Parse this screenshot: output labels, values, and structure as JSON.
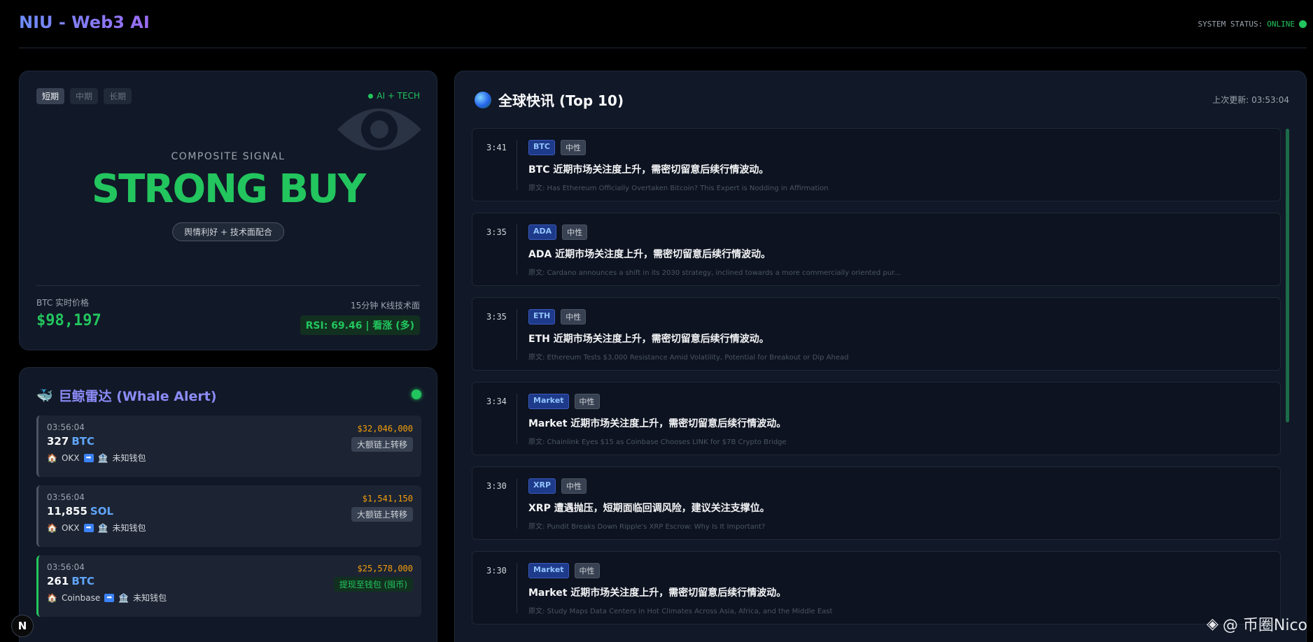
{
  "header": {
    "brand": "NIU - Web3 AI",
    "status_label": "SYSTEM STATUS:",
    "status_value": "ONLINE"
  },
  "signal": {
    "tabs": [
      "短期",
      "中期",
      "长期"
    ],
    "active_tab": 0,
    "ai_tag": "AI + TECH",
    "composite_label": "COMPOSITE SIGNAL",
    "signal_value": "STRONG BUY",
    "reason": "舆情利好 + 技术面配合",
    "price_label": "BTC 实时价格",
    "price": "$98,197",
    "kline_label": "15分钟 K线技术面",
    "rsi": "RSI: 69.46 | 看涨 (多)"
  },
  "whale": {
    "title": "巨鲸雷达 (Whale Alert)",
    "items": [
      {
        "time": "03:56:04",
        "usd": "$32,046,000",
        "amount": "327",
        "coin": "BTC",
        "type": "大额链上转移",
        "from": "OKX",
        "to": "未知钱包",
        "highlight": false
      },
      {
        "time": "03:56:04",
        "usd": "$1,541,150",
        "amount": "11,855",
        "coin": "SOL",
        "type": "大额链上转移",
        "from": "OKX",
        "to": "未知钱包",
        "highlight": false
      },
      {
        "time": "03:56:04",
        "usd": "$25,578,000",
        "amount": "261",
        "coin": "BTC",
        "type": "提现至钱包 (囤币)",
        "from": "Coinbase",
        "to": "未知钱包",
        "highlight": true
      }
    ]
  },
  "news": {
    "title": "全球快讯 (Top 10)",
    "updated": "上次更新: 03:53:04",
    "items": [
      {
        "time": "3:41",
        "coin": "BTC",
        "sentiment": "中性",
        "headline": "BTC 近期市场关注度上升，需密切留意后续行情波动。",
        "source": "原文: Has Ethereum Officially Overtaken Bitcoin? This Expert is Nodding in Affirmation"
      },
      {
        "time": "3:35",
        "coin": "ADA",
        "sentiment": "中性",
        "headline": "ADA 近期市场关注度上升，需密切留意后续行情波动。",
        "source": "原文: Cardano announces a shift in its 2030 strategy, inclined towards a more commercially oriented pur..."
      },
      {
        "time": "3:35",
        "coin": "ETH",
        "sentiment": "中性",
        "headline": "ETH 近期市场关注度上升，需密切留意后续行情波动。",
        "source": "原文: Ethereum Tests $3,000 Resistance Amid Volatility, Potential for Breakout or Dip Ahead"
      },
      {
        "time": "3:34",
        "coin": "Market",
        "sentiment": "中性",
        "headline": "Market 近期市场关注度上升，需密切留意后续行情波动。",
        "source": "原文: Chainlink Eyes $15 as Coinbase Chooses LINK for $7B Crypto Bridge"
      },
      {
        "time": "3:30",
        "coin": "XRP",
        "sentiment": "中性",
        "headline": "XRP 遭遇抛压，短期面临回调风险，建议关注支撑位。",
        "source": "原文: Pundit Breaks Down Ripple's XRP Escrow: Why Is It Important?"
      },
      {
        "time": "3:30",
        "coin": "Market",
        "sentiment": "中性",
        "headline": "Market 近期市场关注度上升，需密切留意后续行情波动。",
        "source": "原文: Study Maps Data Centers in Hot Climates Across Asia, Africa, and the Middle East"
      }
    ]
  },
  "footer": {
    "logo_letter": "N",
    "watermark": "@ 币圈Nico"
  }
}
